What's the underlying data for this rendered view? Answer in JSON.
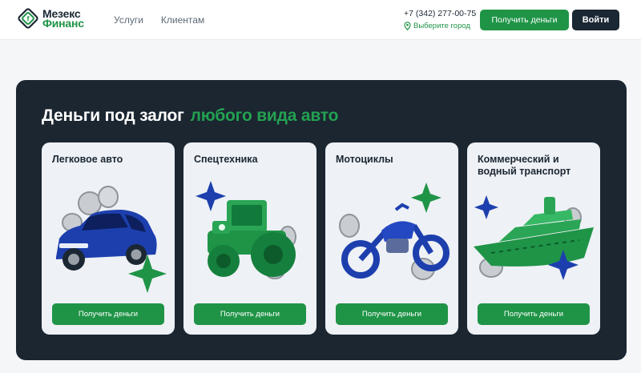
{
  "header": {
    "logo": {
      "line1": "Мезекс",
      "line2": "Финанс"
    },
    "nav": [
      {
        "label": "Услуги"
      },
      {
        "label": "Клиентам"
      }
    ],
    "phone": "+7 (342) 277-00-75",
    "city_label": "Выберите город",
    "get_money_label": "Получить деньги",
    "login_label": "Войти"
  },
  "promo": {
    "headline_white": "Деньги под залог",
    "headline_green": "любого вида авто",
    "cards": [
      {
        "title": "Легковое авто",
        "button": "Получить деньги",
        "icon": "car"
      },
      {
        "title": "Спецтехника",
        "button": "Получить деньги",
        "icon": "tractor"
      },
      {
        "title": "Мотоциклы",
        "button": "Получить деньги",
        "icon": "motorcycle"
      },
      {
        "title": "Коммерческий и водный транспорт",
        "button": "Получить деньги",
        "icon": "ship"
      }
    ]
  },
  "colors": {
    "brand_green": "#1f9447",
    "dark": "#1b2631",
    "headline_green": "#23a151"
  }
}
